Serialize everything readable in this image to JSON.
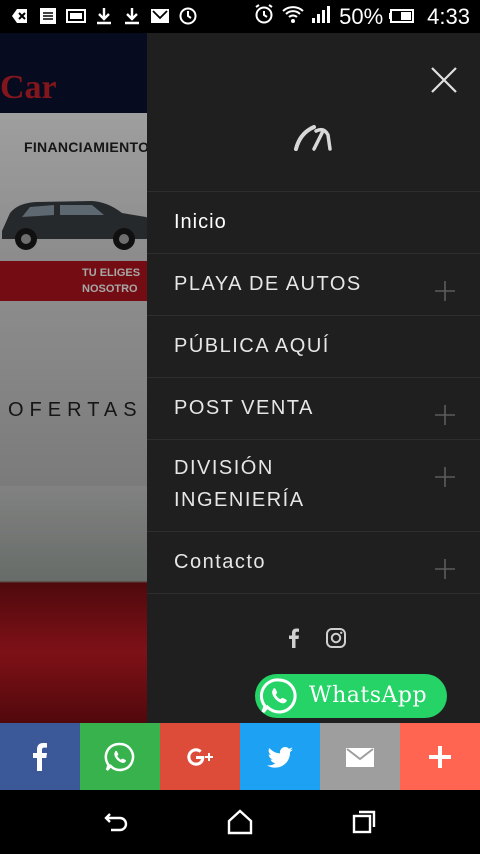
{
  "status_bar": {
    "battery_text": "50%",
    "time": "4:33",
    "icons": [
      "add-icon",
      "notes-icon",
      "gallery-icon",
      "download-icon",
      "download-icon",
      "mail-icon",
      "sync-icon",
      "alarm-icon",
      "wifi-icon",
      "signal-icon",
      "battery-icon"
    ]
  },
  "background_page": {
    "logo_text": "Car",
    "banner_title": "FINANCIAMIENTO",
    "strip_line1": "TU ELIGES",
    "strip_line2": "NOSOTRO",
    "ofertas": "OFERTAS"
  },
  "drawer": {
    "menu": [
      {
        "label": "Inicio",
        "expandable": false
      },
      {
        "label": "PLAYA DE AUTOS",
        "expandable": true
      },
      {
        "label": "PÚBLICA AQUÍ",
        "expandable": false
      },
      {
        "label": "POST VENTA",
        "expandable": true
      },
      {
        "label_line1": "DIVISIÓN",
        "label_line2": "INGENIERÍA",
        "expandable": true
      },
      {
        "label": "Contacto",
        "expandable": true
      }
    ],
    "social": [
      "facebook-icon",
      "instagram-icon"
    ]
  },
  "whatsapp": {
    "label": "WhatsApp",
    "color": "#25d366"
  },
  "share_bar": [
    {
      "name": "facebook",
      "color": "#3b5998"
    },
    {
      "name": "whatsapp",
      "color": "#37b24d"
    },
    {
      "name": "google-plus",
      "color": "#dd4b39"
    },
    {
      "name": "twitter",
      "color": "#1da1f2"
    },
    {
      "name": "email",
      "color": "#9e9e9e"
    },
    {
      "name": "more",
      "color": "#ff6550"
    }
  ]
}
